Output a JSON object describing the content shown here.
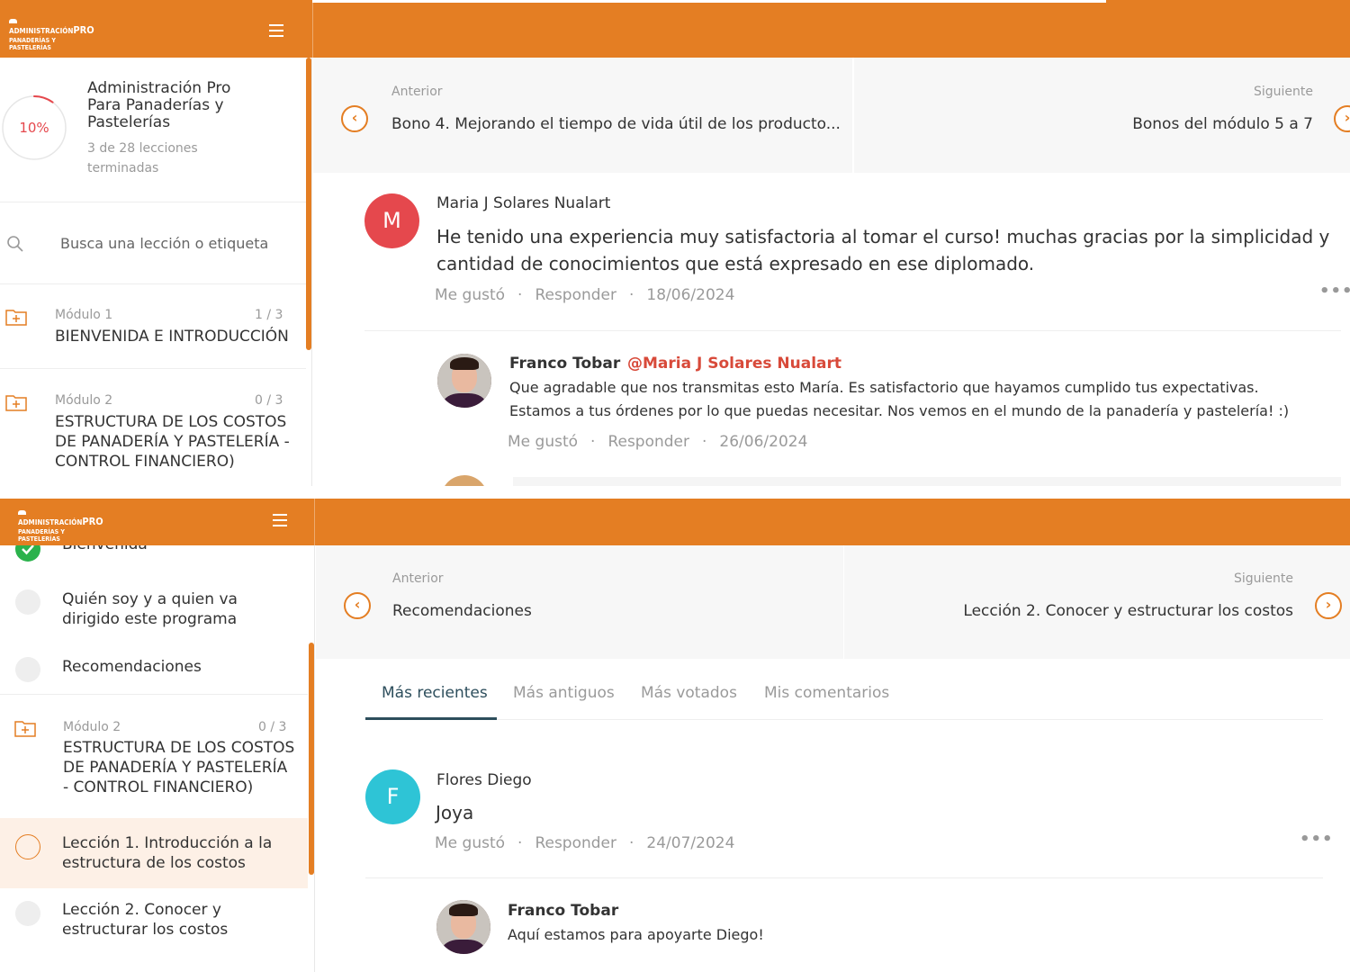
{
  "logo": {
    "line1": "ADMINISTRACIÓN",
    "pro": "PRO",
    "line2": "PANADERÍAS Y PASTELERÍAS"
  },
  "colors": {
    "brand": "#e47e23",
    "tab_active": "#2d4e5c",
    "mention": "#d84a3a",
    "avatar_m": "#e5484d",
    "avatar_f": "#2ec4d6",
    "check": "#2bb24c"
  },
  "panel1": {
    "course": {
      "progress_label": "10%",
      "progress_value": 0.1,
      "title": "Administración Pro Para Panaderías y Pastelerías",
      "lessons_done": "3 de 28 lecciones terminadas"
    },
    "search_placeholder": "Busca una lección o etiqueta",
    "modules": [
      {
        "label": "Módulo 1",
        "count": "1 / 3",
        "title": "BIENVENIDA E INTRODUCCIÓN"
      },
      {
        "label": "Módulo 2",
        "count": "0 / 3",
        "title": "ESTRUCTURA DE LOS COSTOS DE PANADERÍA Y PASTELERÍA - CONTROL FINANCIERO)"
      }
    ],
    "nav": {
      "prev_label": "Anterior",
      "prev_title": "Bono 4. Mejorando el tiempo de vida útil de los producto...",
      "next_label": "Siguiente",
      "next_title": "Bonos del módulo 5 a 7"
    },
    "comment": {
      "avatar": "M",
      "author": "Maria J Solares Nualart",
      "body": "He tenido una experiencia muy satisfactoria al tomar el curso! muchas gracias por la simplicidad y cantidad de conocimientos que está expresado en ese diplomado.",
      "like": "Me gustó",
      "reply": "Responder",
      "date": "18/06/2024",
      "sep": "·"
    },
    "reply": {
      "author": "Franco Tobar",
      "mention": "@Maria J Solares Nualart",
      "body": "Que agradable que nos transmitas esto María. Es satisfactorio que hayamos cumplido tus expectativas. Estamos a tus órdenes por lo que puedas necesitar. Nos vemos en el mundo de la panadería y pastelería! :)",
      "like": "Me gustó",
      "reply": "Responder",
      "date": "26/06/2024",
      "sep": "·"
    }
  },
  "panel2": {
    "lessons_top": [
      {
        "title": "Bienvenida",
        "done": true
      },
      {
        "title": "Quién soy y a quien va dirigido este programa",
        "done": false
      },
      {
        "title": "Recomendaciones",
        "done": false
      }
    ],
    "module": {
      "label": "Módulo 2",
      "count": "0 / 3",
      "title": "ESTRUCTURA DE LOS COSTOS DE PANADERÍA Y PASTELERÍA - CONTROL FINANCIERO)"
    },
    "lessons_bottom": [
      {
        "title": "Lección 1. Introducción a la estructura de los costos",
        "active": true
      },
      {
        "title": "Lección 2. Conocer y estructurar los costos",
        "active": false
      }
    ],
    "nav": {
      "prev_label": "Anterior",
      "prev_title": "Recomendaciones",
      "next_label": "Siguiente",
      "next_title": "Lección 2. Conocer y estructurar los costos"
    },
    "tabs": [
      "Más recientes",
      "Más antiguos",
      "Más votados",
      "Mis comentarios"
    ],
    "comment": {
      "avatar": "F",
      "author": "Flores Diego",
      "body": "Joya",
      "like": "Me gustó",
      "reply": "Responder",
      "date": "24/07/2024",
      "sep": "·"
    },
    "reply": {
      "author": "Franco Tobar",
      "body": "Aquí estamos para apoyarte Diego!"
    }
  }
}
